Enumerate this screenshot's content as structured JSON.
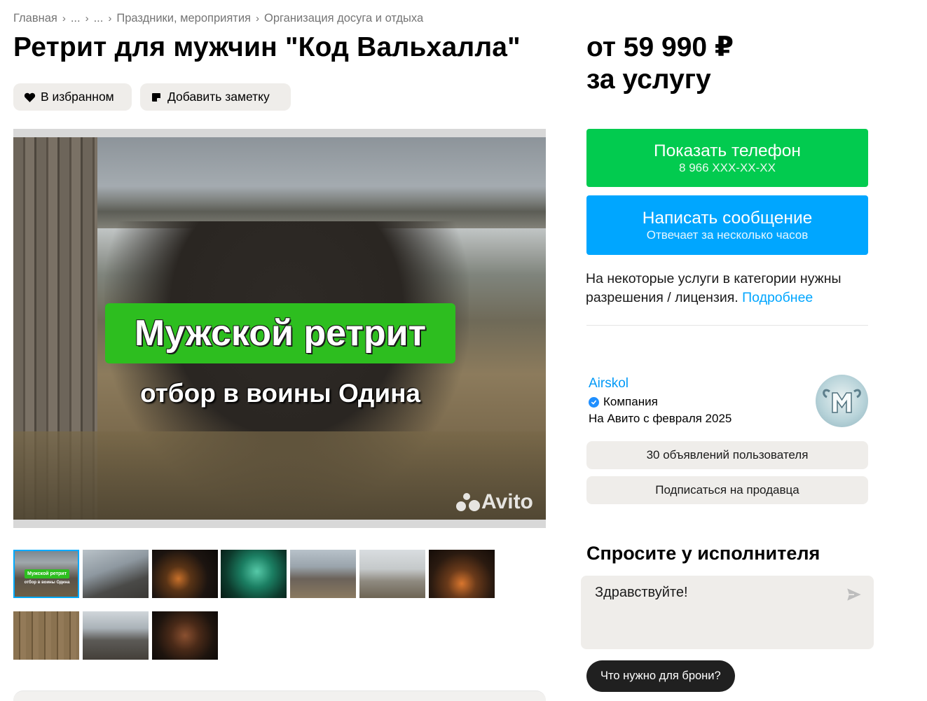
{
  "breadcrumb": {
    "items": [
      "Главная",
      "...",
      "...",
      "Праздники, мероприятия",
      "Организация досуга и отдыха"
    ]
  },
  "listing": {
    "title": "Ретрит для мужчин \"Код Вальхалла\"",
    "favorite_label": "В избранном",
    "note_label": "Добавить заметку"
  },
  "image": {
    "banner_title": "Мужской ретрит",
    "banner_subtitle": "отбор в воины Одина",
    "watermark": "Avito",
    "thumb_banner": "Мужской ретрит",
    "thumb_sub": "отбор в воины Одина"
  },
  "price": {
    "line1": "от 59 990 ₽",
    "line2": "за услугу"
  },
  "contact": {
    "phone_label": "Показать телефон",
    "phone_masked": "8 966 XXX-XX-XX",
    "message_label": "Написать сообщение",
    "message_sub": "Отвечает за несколько часов"
  },
  "permits": {
    "text": "На некоторые услуги в категории нужны разрешения / лицензия.",
    "link": "Подробнее"
  },
  "seller": {
    "name": "Airskol",
    "type": "Компания",
    "since": "На Авито с февраля 2025",
    "ads_button": "30 объявлений пользователя",
    "subscribe_button": "Подписаться на продавца"
  },
  "ask": {
    "title": "Спросите у исполнителя",
    "message_value": "Здравствуйте!",
    "quick_question": "Что нужно для брони?"
  },
  "colors": {
    "green": "#02cb4f",
    "blue": "#00a6ff",
    "link": "#0099f7",
    "pill_bg": "#efedea"
  }
}
